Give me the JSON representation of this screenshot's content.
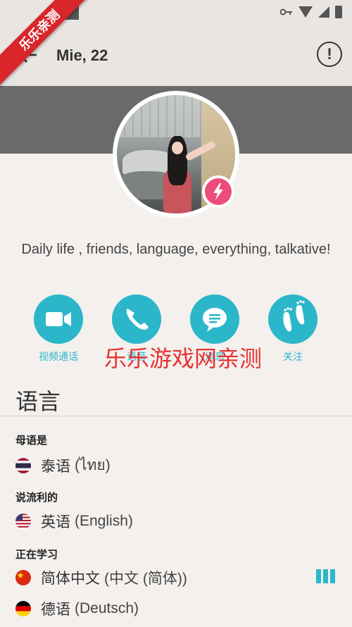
{
  "ribbon_text": "乐乐亲测",
  "header": {
    "title": "Mie, 22",
    "report_symbol": "!"
  },
  "bio": "Daily life , friends, language, everything, talkative!",
  "actions": [
    {
      "label": "视频通话",
      "icon": "video-camera-icon"
    },
    {
      "label": "语音",
      "icon": "phone-icon"
    },
    {
      "label": "消息",
      "icon": "chat-bubble-icon"
    },
    {
      "label": "关注",
      "icon": "footprints-icon"
    }
  ],
  "watermark": "乐乐游戏网亲测",
  "languages": {
    "title": "语言",
    "native_label": "母语是",
    "native": {
      "name": "泰语",
      "native": "(ไทย)"
    },
    "fluent_label": "说流利的",
    "fluent": {
      "name": "英语",
      "native": "(English)"
    },
    "learning_label": "正在学习",
    "learning": [
      {
        "name": "简体中文",
        "native": "(中文 (简体))",
        "level_bars": 3,
        "level_filled": 3
      },
      {
        "name": "德语",
        "native": "(Deutsch)"
      }
    ]
  },
  "colors": {
    "accent": "#2bb7c9",
    "badge": "#ec4b7c",
    "band": "#6a6a6a",
    "ribbon": "#d9262a"
  }
}
